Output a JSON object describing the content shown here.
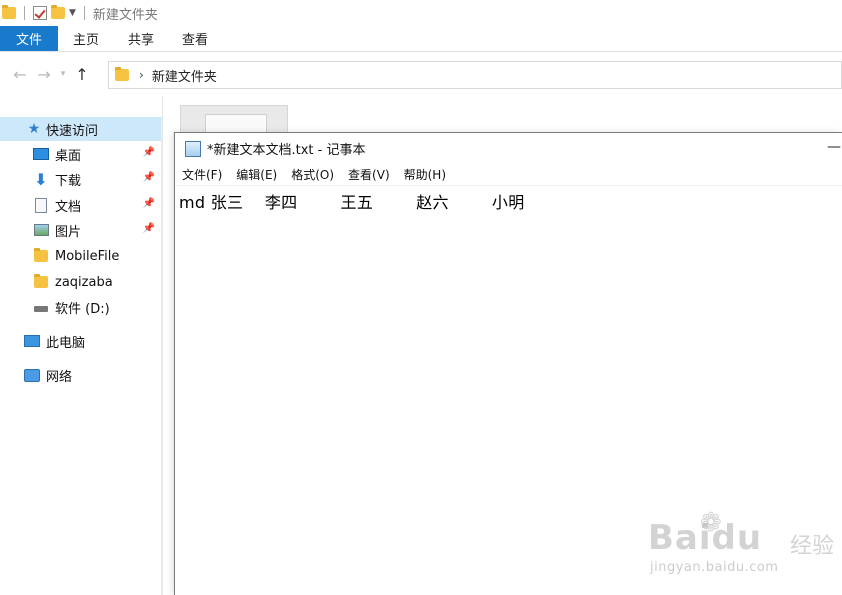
{
  "explorer": {
    "title": "新建文件夹",
    "ribbon_tabs": [
      "文件",
      "主页",
      "共享",
      "查看"
    ],
    "address_path": "新建文件夹"
  },
  "nav_pane": {
    "quick_access": "快速访问",
    "items": [
      {
        "label": "桌面",
        "icon": "desktop-icon",
        "pinned": true
      },
      {
        "label": "下载",
        "icon": "download-icon",
        "pinned": true
      },
      {
        "label": "文档",
        "icon": "document-icon",
        "pinned": true
      },
      {
        "label": "图片",
        "icon": "pictures-icon",
        "pinned": true
      },
      {
        "label": "MobileFile",
        "icon": "folder-icon",
        "pinned": false
      },
      {
        "label": "zaqizaba",
        "icon": "folder-icon",
        "pinned": false
      },
      {
        "label": "软件 (D:)",
        "icon": "drive-icon",
        "pinned": false
      }
    ],
    "this_pc": "此电脑",
    "network": "网络"
  },
  "notepad": {
    "title": "*新建文本文档.txt - 记事本",
    "menu": [
      "文件(F)",
      "编辑(E)",
      "格式(O)",
      "查看(V)",
      "帮助(H)"
    ],
    "content": "md 张三    李四        王五        赵六        小明"
  },
  "watermark": {
    "brand": "Baidu",
    "brand_cn": "经验",
    "url": "jingyan.baidu.com"
  },
  "colors": {
    "accent_blue": "#1979ca",
    "selected_bg": "#cde8fb",
    "folder_yellow": "#f5c242"
  }
}
